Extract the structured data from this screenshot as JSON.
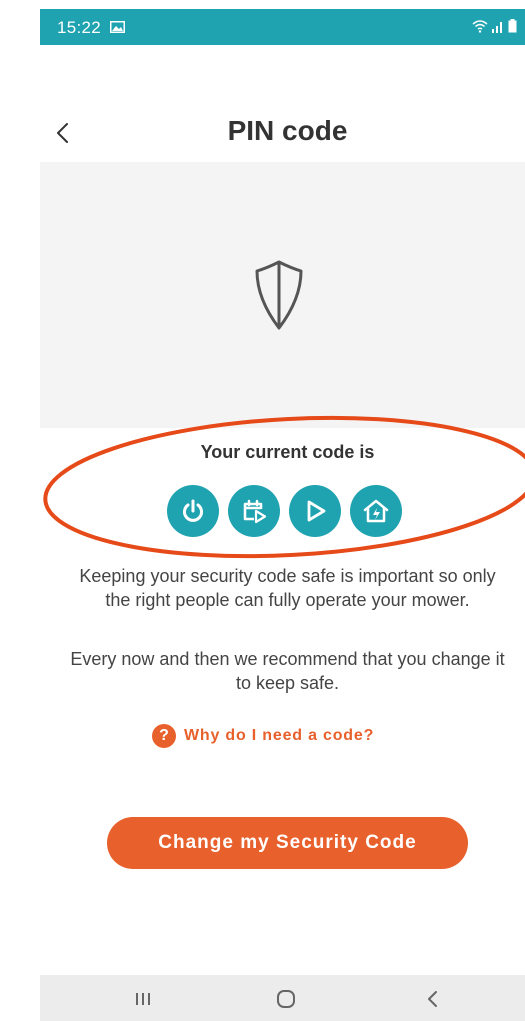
{
  "status_bar": {
    "time": "15:22",
    "icons": [
      "image-icon",
      "wifi-icon",
      "signal-icon",
      "battery-icon"
    ]
  },
  "header": {
    "back_icon": "chevron-left-icon",
    "title": "PIN code"
  },
  "hero": {
    "icon": "shield-icon"
  },
  "code": {
    "label": "Your current code is",
    "icons": [
      "power-icon",
      "calendar-play-icon",
      "play-icon",
      "home-charge-icon"
    ]
  },
  "body": {
    "paragraph_1": "Keeping your security code safe is important so only the right people can fully operate your mower.",
    "paragraph_2": "Every now and then we recommend that you change it to keep safe."
  },
  "help": {
    "icon_glyph": "?",
    "link_text": "Why do I need a code?"
  },
  "actions": {
    "change_button_label": "Change my Security Code"
  },
  "nav_bar": {
    "icons": [
      "recent-apps-icon",
      "home-icon",
      "back-icon"
    ]
  },
  "colors": {
    "teal": "#1fa3b0",
    "orange": "#e8602c",
    "annotation_red": "#e64a19",
    "hero_background": "#f4f4f4"
  }
}
